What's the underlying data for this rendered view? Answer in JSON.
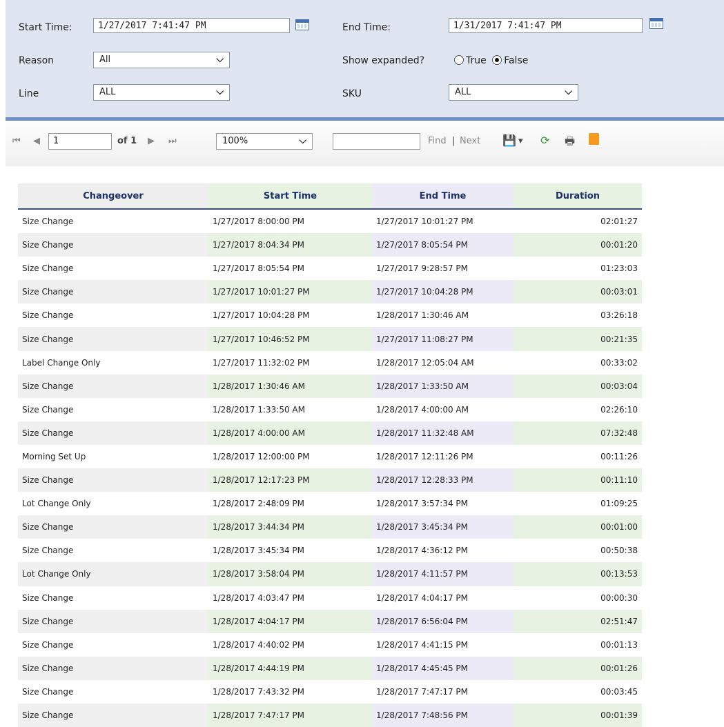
{
  "params": {
    "start_label": "Start Time:",
    "start_value": "1/27/2017 7:41:47 PM",
    "end_label": "End Time:",
    "end_value": "1/31/2017 7:41:47 PM",
    "reason_label": "Reason",
    "reason_value": "All",
    "expanded_label": "Show expanded?",
    "expanded_options": [
      "True",
      "False"
    ],
    "expanded_selected": "False",
    "line_label": "Line",
    "line_value": "ALL",
    "sku_label": "SKU",
    "sku_value": "ALL"
  },
  "toolbar": {
    "page_value": "1",
    "page_of": "of 1",
    "zoom": "100%",
    "find_label": "Find",
    "separator": "|",
    "next_label": "Next",
    "icons": [
      "first-page-icon",
      "prev-page-icon",
      "next-page-icon",
      "last-page-icon",
      "export-icon",
      "refresh-icon",
      "print-icon",
      "feed-icon"
    ]
  },
  "table": {
    "headers": [
      "Changeover",
      "Start Time",
      "End Time",
      "Duration"
    ],
    "rows": [
      [
        "Size Change",
        "1/27/2017 8:00:00 PM",
        "1/27/2017 10:01:27 PM",
        "02:01:27"
      ],
      [
        "Size Change",
        "1/27/2017 8:04:34 PM",
        "1/27/2017 8:05:54 PM",
        "00:01:20"
      ],
      [
        "Size Change",
        "1/27/2017 8:05:54 PM",
        "1/27/2017 9:28:57 PM",
        "01:23:03"
      ],
      [
        "Size Change",
        "1/27/2017 10:01:27 PM",
        "1/27/2017 10:04:28 PM",
        "00:03:01"
      ],
      [
        "Size Change",
        "1/27/2017 10:04:28 PM",
        "1/28/2017 1:30:46 AM",
        "03:26:18"
      ],
      [
        "Size Change",
        "1/27/2017 10:46:52 PM",
        "1/27/2017 11:08:27 PM",
        "00:21:35"
      ],
      [
        "Label Change Only",
        "1/27/2017 11:32:02 PM",
        "1/28/2017 12:05:04 AM",
        "00:33:02"
      ],
      [
        "Size Change",
        "1/28/2017 1:30:46 AM",
        "1/28/2017 1:33:50 AM",
        "00:03:04"
      ],
      [
        "Size Change",
        "1/28/2017 1:33:50 AM",
        "1/28/2017 4:00:00 AM",
        "02:26:10"
      ],
      [
        "Size Change",
        "1/28/2017 4:00:00 AM",
        "1/28/2017 11:32:48 AM",
        "07:32:48"
      ],
      [
        "Morning Set Up",
        "1/28/2017 12:00:00 PM",
        "1/28/2017 12:11:26 PM",
        "00:11:26"
      ],
      [
        "Size Change",
        "1/28/2017 12:17:23 PM",
        "1/28/2017 12:28:33 PM",
        "00:11:10"
      ],
      [
        "Lot Change Only",
        "1/28/2017 2:48:09 PM",
        "1/28/2017 3:57:34 PM",
        "01:09:25"
      ],
      [
        "Size Change",
        "1/28/2017 3:44:34 PM",
        "1/28/2017 3:45:34 PM",
        "00:01:00"
      ],
      [
        "Size Change",
        "1/28/2017 3:45:34 PM",
        "1/28/2017 4:36:12 PM",
        "00:50:38"
      ],
      [
        "Lot Change Only",
        "1/28/2017 3:58:04 PM",
        "1/28/2017 4:11:57 PM",
        "00:13:53"
      ],
      [
        "Size Change",
        "1/28/2017 4:03:47 PM",
        "1/28/2017 4:04:17 PM",
        "00:00:30"
      ],
      [
        "Size Change",
        "1/28/2017 4:04:17 PM",
        "1/28/2017 6:56:04 PM",
        "02:51:47"
      ],
      [
        "Size Change",
        "1/28/2017 4:40:02 PM",
        "1/28/2017 4:41:15 PM",
        "00:01:13"
      ],
      [
        "Size Change",
        "1/28/2017 4:44:19 PM",
        "1/28/2017 4:45:45 PM",
        "00:01:26"
      ],
      [
        "Size Change",
        "1/28/2017 7:43:32 PM",
        "1/28/2017 7:47:17 PM",
        "00:03:45"
      ],
      [
        "Size Change",
        "1/28/2017 7:47:17 PM",
        "1/28/2017 7:48:56 PM",
        "00:01:39"
      ]
    ]
  }
}
